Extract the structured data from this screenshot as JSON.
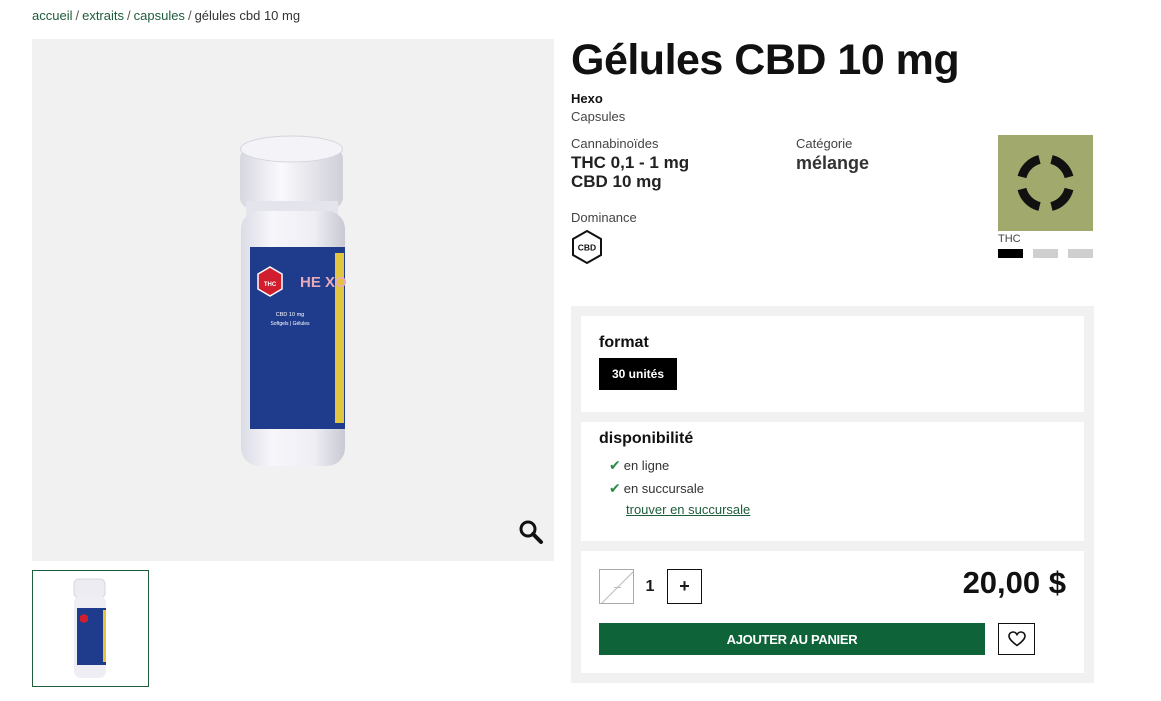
{
  "breadcrumb": {
    "items": [
      "accueil",
      "extraits",
      "capsules"
    ],
    "current": "gélules cbd 10 mg",
    "separator": "/"
  },
  "product": {
    "title": "Gélules CBD 10 mg",
    "brand": "Hexo",
    "subcategory": "Capsules",
    "image_label": {
      "brand_mark": "HE XO",
      "thc_symbol": "THC",
      "line1": "CBD 10 mg",
      "line2": "Softgels | Gélules"
    }
  },
  "specs": {
    "cannabinoids_label": "Cannabinoïdes",
    "thc_value": "THC 0,1 - 1 mg",
    "cbd_value": "CBD 10 mg",
    "category_label": "Catégorie",
    "category_value": "mélange",
    "dominance_label": "Dominance",
    "dominance_badge": "CBD"
  },
  "potency": {
    "label": "THC",
    "level": 1,
    "max_level": 3,
    "tile_color": "#a2a96c"
  },
  "format": {
    "heading": "format",
    "selected": "30 unités"
  },
  "availability": {
    "heading": "disponibilité",
    "online": "en ligne",
    "store": "en succursale",
    "find_link": "trouver en succursale"
  },
  "purchase": {
    "quantity": "1",
    "minus_label": "−",
    "plus_label": "+",
    "price": "20,00 $",
    "add_to_cart": "AJOUTER AU PANIER"
  },
  "colors": {
    "brand_green": "#0f6339",
    "check_green": "#2a8a43",
    "link_green": "#1e5c3a"
  },
  "icons": {
    "zoom": "magnifier-icon",
    "favorite": "heart-icon",
    "check": "checkmark-icon"
  }
}
